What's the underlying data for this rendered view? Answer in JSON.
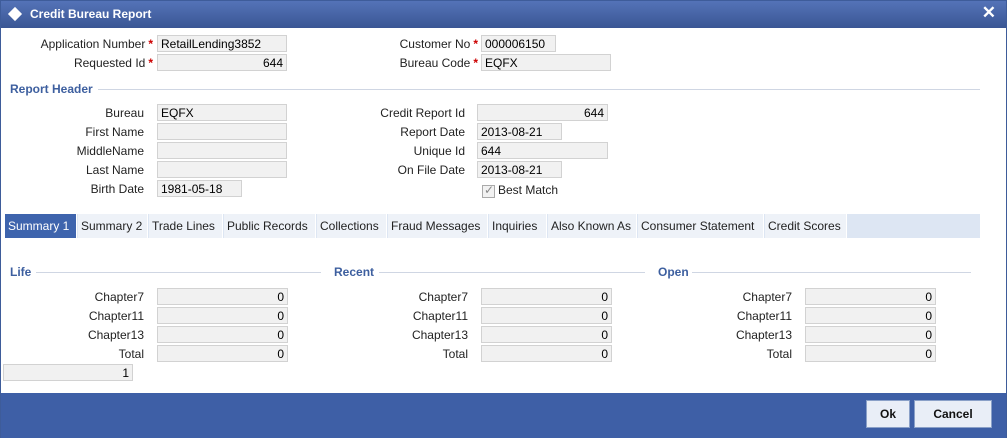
{
  "window": {
    "title": "Credit Bureau Report"
  },
  "top": {
    "application_number_label": "Application Number",
    "application_number": "RetailLending3852",
    "requested_id_label": "Requested Id",
    "requested_id": "644",
    "customer_no_label": "Customer No",
    "customer_no": "000006150",
    "bureau_code_label": "Bureau Code",
    "bureau_code": "EQFX",
    "required_mark": "*"
  },
  "report_header": {
    "section_title": "Report Header",
    "bureau_label": "Bureau",
    "bureau": "EQFX",
    "first_name_label": "First Name",
    "first_name": "",
    "middle_name_label": "MiddleName",
    "middle_name": "",
    "last_name_label": "Last Name",
    "last_name": "",
    "birth_date_label": "Birth Date",
    "birth_date": "1981-05-18",
    "credit_report_id_label": "Credit Report Id",
    "credit_report_id": "644",
    "report_date_label": "Report Date",
    "report_date": "2013-08-21",
    "unique_id_label": "Unique Id",
    "unique_id": "644",
    "on_file_date_label": "On File Date",
    "on_file_date": "2013-08-21",
    "best_match_label": "Best Match"
  },
  "tabs": [
    {
      "label": "Summary 1",
      "active": true
    },
    {
      "label": "Summary 2",
      "active": false
    },
    {
      "label": "Trade Lines",
      "active": false
    },
    {
      "label": "Public Records",
      "active": false
    },
    {
      "label": "Collections",
      "active": false
    },
    {
      "label": "Fraud Messages",
      "active": false
    },
    {
      "label": "Inquiries",
      "active": false
    },
    {
      "label": "Also Known As",
      "active": false
    },
    {
      "label": "Consumer Statement",
      "active": false
    },
    {
      "label": "Credit Scores",
      "active": false
    }
  ],
  "summary": {
    "life": {
      "title": "Life",
      "rows": [
        {
          "label": "Chapter7",
          "value": "0"
        },
        {
          "label": "Chapter11",
          "value": "0"
        },
        {
          "label": "Chapter13",
          "value": "0"
        },
        {
          "label": "Total",
          "value": "0"
        }
      ]
    },
    "recent": {
      "title": "Recent",
      "rows": [
        {
          "label": "Chapter7",
          "value": "0"
        },
        {
          "label": "Chapter11",
          "value": "0"
        },
        {
          "label": "Chapter13",
          "value": "0"
        },
        {
          "label": "Total",
          "value": "0"
        }
      ]
    },
    "open": {
      "title": "Open",
      "rows": [
        {
          "label": "Chapter7",
          "value": "0"
        },
        {
          "label": "Chapter11",
          "value": "0"
        },
        {
          "label": "Chapter13",
          "value": "0"
        },
        {
          "label": "Total",
          "value": "0"
        }
      ]
    },
    "counter": "1"
  },
  "footer": {
    "ok_label": "Ok",
    "cancel_label": "Cancel"
  }
}
